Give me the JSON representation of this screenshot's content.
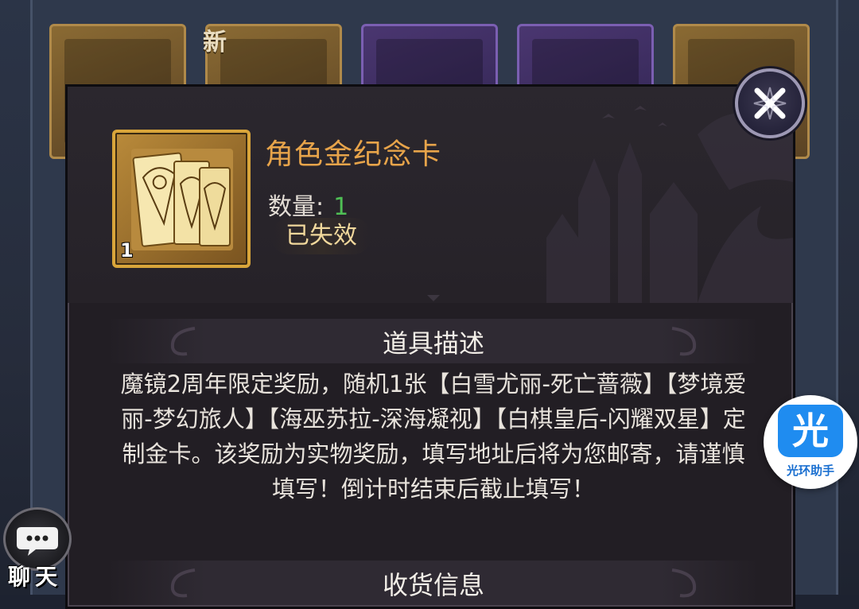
{
  "background": {
    "new_tag": "新"
  },
  "item": {
    "name": "角色金纪念卡",
    "quantity_label": "数量:",
    "quantity_value": "1",
    "stack_count": "1",
    "status": "已失效",
    "icon": "gold-card-icon"
  },
  "description": {
    "section_title": "道具描述",
    "text": "魔镜2周年限定奖励，随机1张【白雪尤丽-死亡蔷薇】【梦境爱丽-梦幻旅人】【海巫苏拉-深海凝视】【白棋皇后-闪耀双星】定制金卡。该奖励为实物奖励，填写地址后将为您邮寄，请谨慎填写！倒计时结束后截止填写！"
  },
  "shipping": {
    "section_title": "收货信息"
  },
  "close_button": {
    "icon": "close-icon"
  },
  "chat_button": {
    "label": "聊天",
    "icon": "chat-bubble-icon"
  },
  "assistant": {
    "glyph": "光",
    "label": "光环助手"
  },
  "colors": {
    "item_name": "#e7a44a",
    "quantity_value": "#4fbf55",
    "status": "#f1d89c",
    "assistant_blue": "#1f8cf0"
  }
}
